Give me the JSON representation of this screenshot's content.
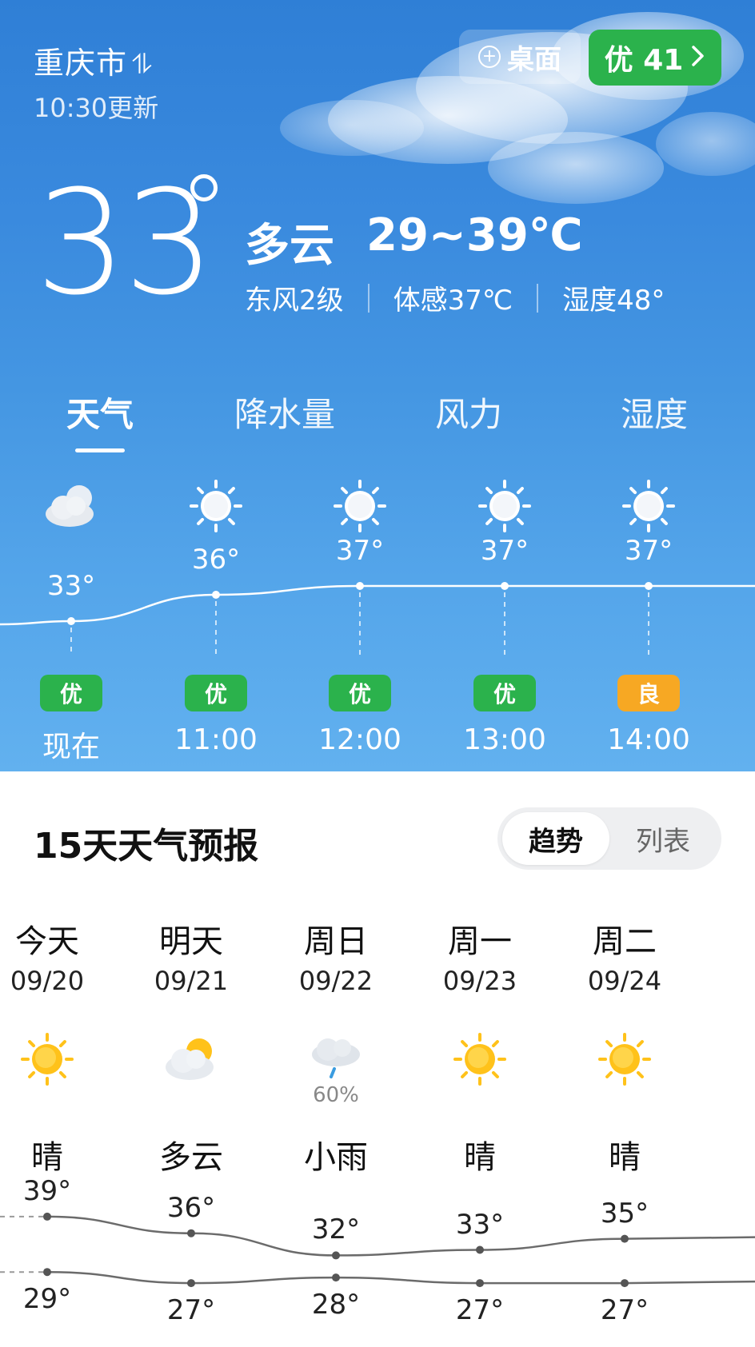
{
  "header": {
    "city": "重庆市",
    "updated": "10:30更新",
    "desk_label": "桌面",
    "aqi_label": "优 41",
    "aqi_color": "#2bb24c"
  },
  "current": {
    "temp": "33",
    "condition": "多云",
    "range": "29~39℃",
    "wind": "东风2级",
    "feels": "体感37℃",
    "humidity": "湿度48°"
  },
  "tabs": [
    "天气",
    "降水量",
    "风力",
    "湿度"
  ],
  "hourly": [
    {
      "time": "现在",
      "temp": "33°",
      "temp_value": 33,
      "icon": "partly-cloudy-icon",
      "aqi": "优",
      "aqi_level": "good"
    },
    {
      "time": "11:00",
      "temp": "36°",
      "temp_value": 36,
      "icon": "sun-icon",
      "aqi": "优",
      "aqi_level": "good"
    },
    {
      "time": "12:00",
      "temp": "37°",
      "temp_value": 37,
      "icon": "sun-icon",
      "aqi": "优",
      "aqi_level": "good"
    },
    {
      "time": "13:00",
      "temp": "37°",
      "temp_value": 37,
      "icon": "sun-icon",
      "aqi": "优",
      "aqi_level": "good"
    },
    {
      "time": "14:00",
      "temp": "37°",
      "temp_value": 37,
      "icon": "sun-icon",
      "aqi": "良",
      "aqi_level": "fair"
    }
  ],
  "forecast": {
    "title": "15天天气预报",
    "toggle": [
      "趋势",
      "列表"
    ],
    "days": [
      {
        "name": "今天",
        "date": "09/20",
        "icon": "sun-icon",
        "cond": "晴",
        "high": "39°",
        "low": "29°",
        "high_value": 39,
        "low_value": 29,
        "pop": ""
      },
      {
        "name": "明天",
        "date": "09/21",
        "icon": "partly-cloudy-icon",
        "cond": "多云",
        "high": "36°",
        "low": "27°",
        "high_value": 36,
        "low_value": 27,
        "pop": ""
      },
      {
        "name": "周日",
        "date": "09/22",
        "icon": "light-rain-icon",
        "cond": "小雨",
        "high": "32°",
        "low": "28°",
        "high_value": 32,
        "low_value": 28,
        "pop": "60%"
      },
      {
        "name": "周一",
        "date": "09/23",
        "icon": "sun-icon",
        "cond": "晴",
        "high": "33°",
        "low": "27°",
        "high_value": 33,
        "low_value": 27,
        "pop": ""
      },
      {
        "name": "周二",
        "date": "09/24",
        "icon": "sun-icon",
        "cond": "晴",
        "high": "35°",
        "low": "27°",
        "high_value": 35,
        "low_value": 27,
        "pop": ""
      }
    ]
  },
  "colors": {
    "aqi_good": "#2bb24c",
    "aqi_fair": "#f7a823",
    "sun": "#ffc21a"
  }
}
